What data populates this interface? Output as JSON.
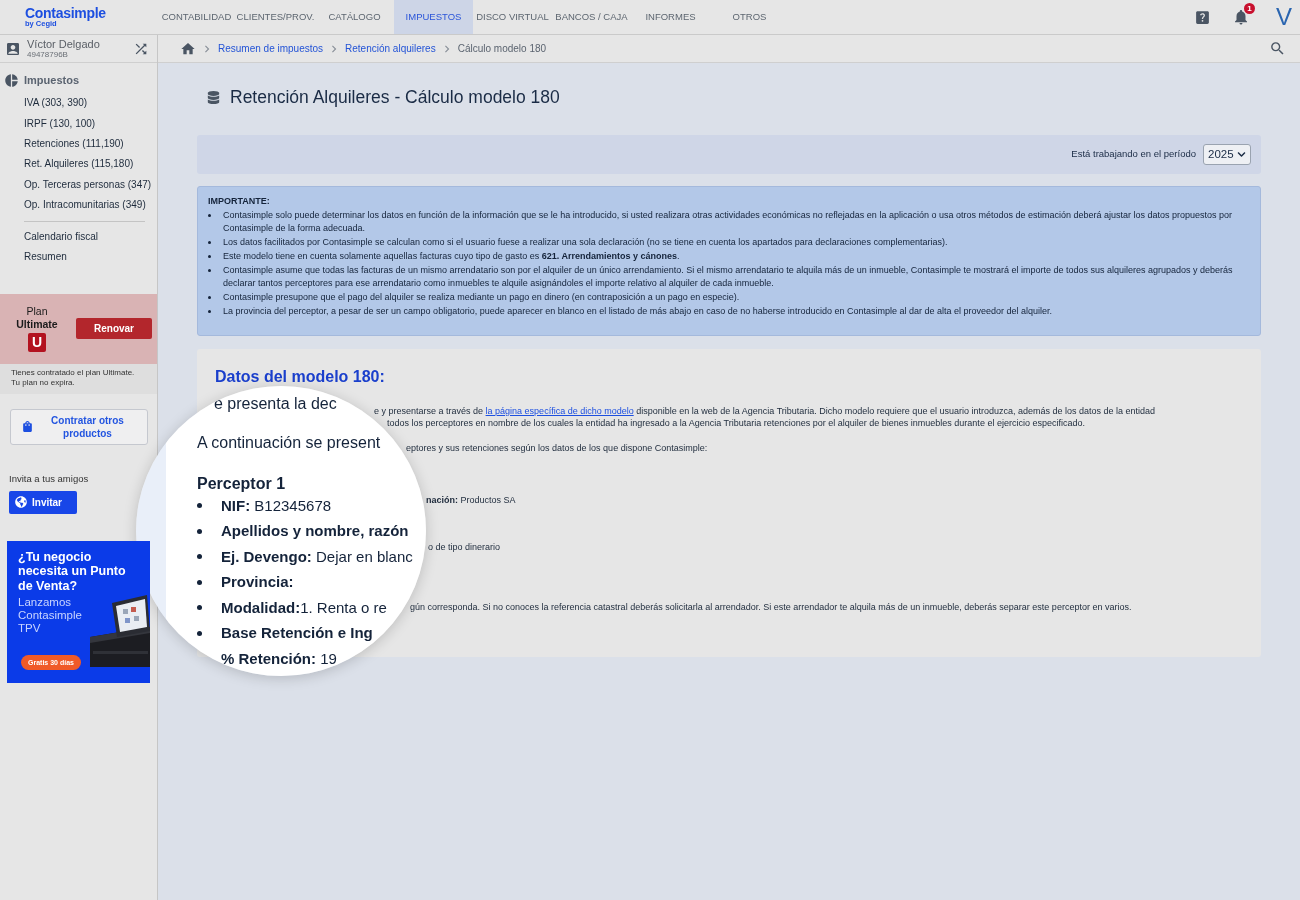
{
  "header": {
    "logo": {
      "name": "Contasimple",
      "tagline": "by Cegid"
    },
    "tabs": [
      {
        "label": "CONTABILIDAD",
        "selected": false
      },
      {
        "label": "CLIENTES/PROV.",
        "selected": false
      },
      {
        "label": "CATÁLOGO",
        "selected": false
      },
      {
        "label": "IMPUESTOS",
        "selected": true
      },
      {
        "label": "DISCO VIRTUAL",
        "selected": false
      },
      {
        "label": "BANCOS / CAJA",
        "selected": false
      },
      {
        "label": "INFORMES",
        "selected": false
      },
      {
        "label": "OTROS",
        "selected": false
      }
    ],
    "notification_count": "1",
    "user_initial": "V"
  },
  "account": {
    "name": "Víctor Delgado",
    "tax_id": "49478796B"
  },
  "sidebar": {
    "section": "Impuestos",
    "items": [
      "IVA (303, 390)",
      "IRPF (130, 100)",
      "Retenciones (111,190)",
      "Ret. Alquileres (115,180)",
      "Op. Terceras personas (347)",
      "Op. Intracomunitarias (349)"
    ],
    "links": [
      "Calendario fiscal",
      "Resumen"
    ]
  },
  "plan": {
    "label": "Plan",
    "name": "Ultimate",
    "badge": "U",
    "renew_button": "Renovar",
    "note": [
      "Tienes contratado el plan Ultimate.",
      "Tu plan no expira."
    ]
  },
  "products_button": "Contratar otros productos",
  "invite": {
    "label": "Invita a tus amigos",
    "button": "Invitar"
  },
  "ad": {
    "headline": "¿Tu negocio necesita un Punto de Venta?",
    "body": "Lanzamos Contasimple TPV",
    "offer": "Gratis 30 días"
  },
  "breadcrumb": [
    {
      "label": "Resumen de impuestos",
      "kind": "link"
    },
    {
      "label": "Retención alquileres",
      "kind": "link"
    },
    {
      "label": "Cálculo modelo 180",
      "kind": "current"
    }
  ],
  "page_title": "Retención Alquileres - Cálculo modelo 180",
  "period": {
    "label": "Está trabajando en el período",
    "value": "2025"
  },
  "notice": {
    "title": "IMPORTANTE:",
    "items": [
      "Contasimple solo puede determinar los datos en función de la información que se le ha introducido, si usted realizara otras actividades económicas no reflejadas en la aplicación o usa otros métodos de estimación deberá ajustar los datos propuestos por Contasimple de la forma adecuada.",
      "Los datos facilitados por Contasimple se calculan como si el usuario fuese a realizar una sola declaración (no se tiene en cuenta los apartados para declaraciones complementarias).",
      "Este modelo tiene en cuenta solamente aquellas facturas cuyo tipo de gasto es **621. Arrendamientos y cánones**.",
      "Contasimple asume que todas las facturas de un mismo arrendatario son por el alquiler de un único arrendamiento. Si el mismo arrendatario te alquila más de un inmueble, Contasimple te mostrará el importe de todos sus alquileres agrupados y deberás declarar tantos perceptores para ese arrendatario como inmuebles te alquile asignándoles el importe relativo al alquiler de cada inmueble.",
      "Contasimple presupone que el pago del alquiler se realiza mediante un pago en dinero (en contraposición a un pago en especie).",
      "La provincia del perceptor, a pesar de ser un campo obligatorio, puede aparecer en blanco en el listado de más abajo en caso de no haberse introducido en Contasimple al dar de alta el proveedor del alquiler."
    ]
  },
  "data_section": {
    "title": "Datos del modelo 180:",
    "lines": [
      {
        "kind": "link_line",
        "before": "e y presentarse a través de",
        "link": "la página específica de dicho modelo",
        "after": "disponible en la web de la Agencia Tributaria. Dicho modelo requiere que el usuario introduzca, además de los datos de la entidad"
      },
      {
        "kind": "text",
        "text": "todos los perceptores en nombre de los cuales la entidad ha ingresado a la Agencia Tributaria retenciones por el alquiler de bienes inmuebles durante el ejercicio especificado."
      },
      {
        "kind": "text",
        "text": "eptores y sus retenciones según los datos de los que dispone Contasimple:"
      },
      {
        "kind": "text",
        "text": "**nación:** Productos SA"
      },
      {
        "kind": "text",
        "text": "o de tipo dinerario"
      },
      {
        "kind": "text",
        "text": "gún corresponda. Si no conoces la referencia catastral deberás solicitarla al arrendador. Si este arrendador te alquila más de un inmueble, deberás separar este perceptor en varios."
      }
    ]
  },
  "magnifier": {
    "lines": [
      {
        "kind": "text",
        "text": "e presenta la dec"
      },
      {
        "kind": "text",
        "text": "A continuación se present"
      },
      {
        "kind": "heading",
        "text": "Perceptor 1"
      }
    ],
    "items": [
      {
        "text": "**NIF:** B12345678",
        "bullet": true
      },
      {
        "text": "**Apellidos y nombre, razón**",
        "bullet": true
      },
      {
        "text": "**Ej. Devengo:** Dejar en blanc",
        "bullet": true
      },
      {
        "text": "**Provincia:**",
        "bullet": true
      },
      {
        "text": "**Modalidad:**1. Renta o re",
        "bullet": true
      },
      {
        "text": "**Base Retención e Ing**",
        "bullet": true
      },
      {
        "text": "**% Retención:** 19",
        "bullet": false
      }
    ]
  }
}
